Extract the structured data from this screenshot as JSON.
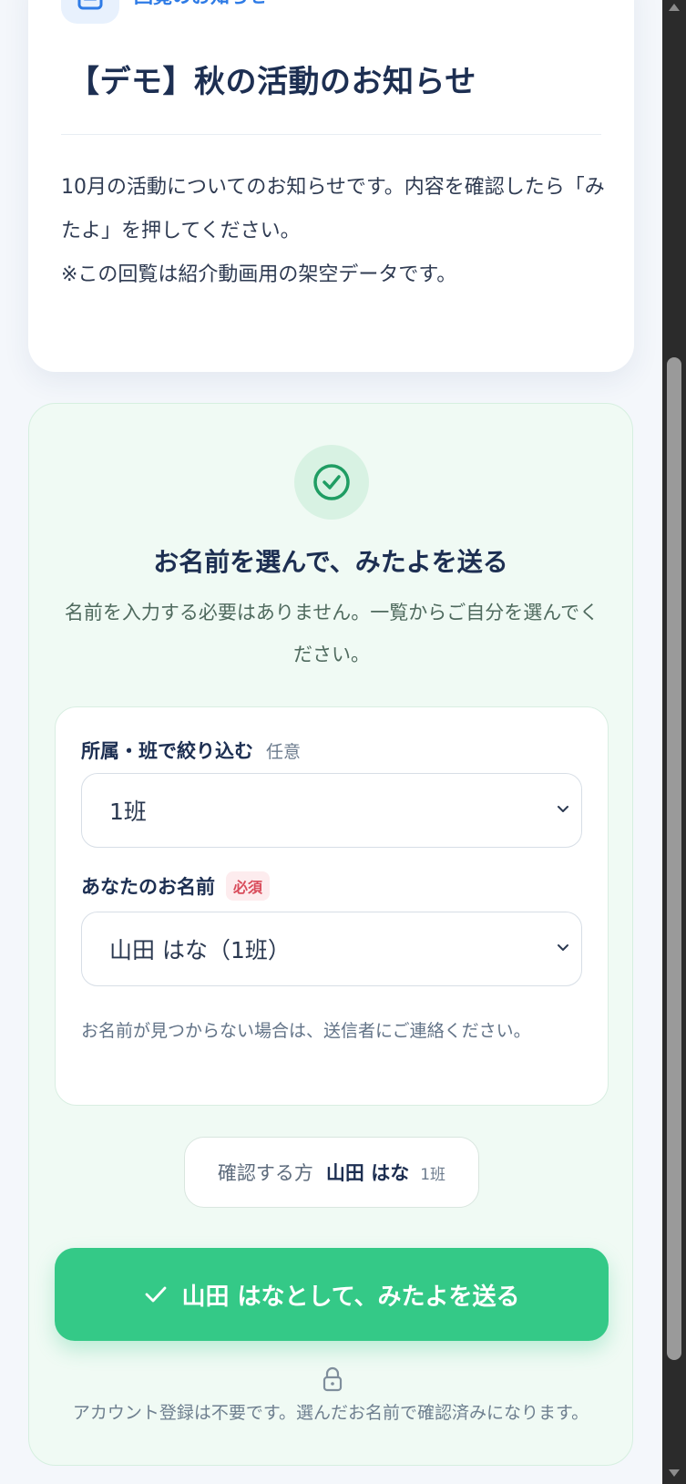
{
  "notice": {
    "category_label": "回覧のお知らせ",
    "title": "【デモ】秋の活動のお知らせ",
    "body_lines": [
      "10月の活動についてのお知らせです。内容を確認したら「みたよ」を押してください。",
      "※この回覧は紹介動画用の架空データです。"
    ]
  },
  "confirm": {
    "heading": "お名前を選んで、みたよを送る",
    "subtext": "名前を入力する必要はありません。一覧からご自分を選んでください。",
    "group_filter": {
      "label": "所属・班で絞り込む",
      "tag": "任意",
      "selected": "1班"
    },
    "name_select": {
      "label": "あなたのお名前",
      "tag": "必須",
      "selected": "山田 はな（1班）"
    },
    "help_text": "お名前が見つからない場合は、送信者にご連絡ください。",
    "selected_person": {
      "label": "確認する方",
      "name": "山田 はな",
      "group": "1班"
    },
    "submit_label": "山田 はなとして、みたよを送る",
    "footer_note": "アカウント登録は不要です。選んだお名前で確認済みになります。"
  },
  "colors": {
    "accent_green": "#34c987",
    "panel_green": "#f0faf4",
    "title_navy": "#1d2f52",
    "required_red": "#d94c5b",
    "link_blue": "#2e7be6"
  },
  "icons": {
    "category": "document-icon",
    "confirm": "check-circle-icon",
    "submit": "check-icon",
    "footer": "lock-icon",
    "select": "chevron-down-icon"
  }
}
